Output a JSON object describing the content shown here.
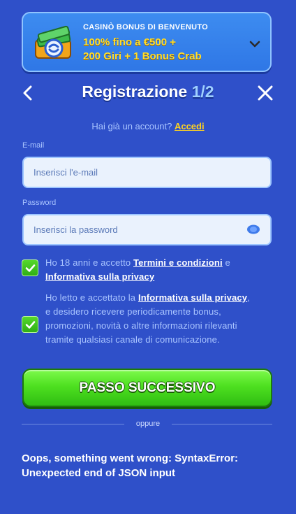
{
  "banner": {
    "kicker": "CASINÒ BONUS DI BENVENUTO",
    "line1": "100% fino a €500 +",
    "line2": "200 Giri + 1 Bonus Crab",
    "icon": "money-stack-icon",
    "expand_icon": "chevron-down-icon"
  },
  "header": {
    "title_main": "Registrazione ",
    "title_step": "1/2",
    "back_icon": "chevron-left-icon",
    "close_icon": "close-icon"
  },
  "login": {
    "prompt": "Hai già un account?",
    "link": "Accedi"
  },
  "form": {
    "email_label": "E-mail",
    "email_placeholder": "Inserisci l'e-mail",
    "email_value": "",
    "password_label": "Password",
    "password_placeholder": "Inserisci la password",
    "password_value": "",
    "password_toggle_icon": "eye-icon"
  },
  "consents": [
    {
      "checked": true,
      "text_before": "Ho 18 anni e accetto ",
      "link1": "Termini e condizioni",
      "text_middle": " e ",
      "link2": "Informativa sulla privacy"
    },
    {
      "checked": true,
      "text_before": "Ho letto e accettato la ",
      "link1": "Informativa sulla privacy",
      "text_after": ", e desidero ricevere periodicamente bonus, promozioni, novità o altre informazioni rilevanti tramite qualsiasi canale di comunicazione."
    }
  ],
  "cta": {
    "label": "PASSO SUCCESSIVO"
  },
  "divider": {
    "label": "oppure"
  },
  "error": {
    "message": "Oops, something went wrong: SyntaxError: Unexpected end of JSON input"
  },
  "colors": {
    "background": "#2f50c9",
    "accent_yellow": "#ffd21f",
    "cta_green": "#4ee020",
    "checkbox_green": "#3fc41d"
  }
}
